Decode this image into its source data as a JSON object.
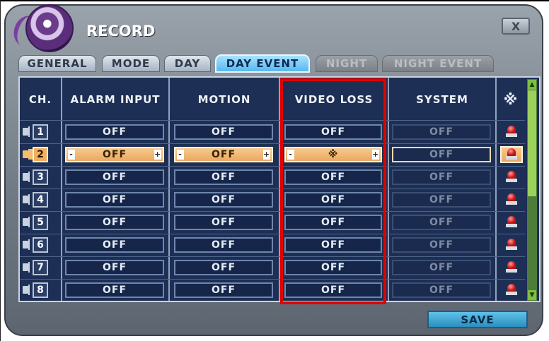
{
  "window": {
    "title": "RECORD",
    "close_label": "X"
  },
  "tabs": [
    {
      "label": "GENERAL",
      "state": "normal"
    },
    {
      "label": "MODE",
      "state": "normal"
    },
    {
      "label": "DAY",
      "state": "normal"
    },
    {
      "label": "DAY EVENT",
      "state": "active"
    },
    {
      "label": "NIGHT",
      "state": "disabled"
    },
    {
      "label": "NIGHT EVENT",
      "state": "disabled"
    }
  ],
  "table": {
    "headers": {
      "ch": "CH.",
      "alarm_input": "ALARM INPUT",
      "motion": "MOTION",
      "video_loss": "VIDEO LOSS",
      "system": "SYSTEM",
      "icon": "※"
    },
    "selected_row": 2,
    "rows": [
      {
        "ch": "1",
        "alarm_input": "OFF",
        "motion": "OFF",
        "video_loss": "OFF",
        "system": "OFF"
      },
      {
        "ch": "2",
        "alarm_input": "OFF",
        "motion": "OFF",
        "video_loss": "※",
        "system": "OFF"
      },
      {
        "ch": "3",
        "alarm_input": "OFF",
        "motion": "OFF",
        "video_loss": "OFF",
        "system": "OFF"
      },
      {
        "ch": "4",
        "alarm_input": "OFF",
        "motion": "OFF",
        "video_loss": "OFF",
        "system": "OFF"
      },
      {
        "ch": "5",
        "alarm_input": "OFF",
        "motion": "OFF",
        "video_loss": "OFF",
        "system": "OFF"
      },
      {
        "ch": "6",
        "alarm_input": "OFF",
        "motion": "OFF",
        "video_loss": "OFF",
        "system": "OFF"
      },
      {
        "ch": "7",
        "alarm_input": "OFF",
        "motion": "OFF",
        "video_loss": "OFF",
        "system": "OFF"
      },
      {
        "ch": "8",
        "alarm_input": "OFF",
        "motion": "OFF",
        "video_loss": "OFF",
        "system": "OFF"
      }
    ],
    "stepper": {
      "minus": "-",
      "plus": "+"
    }
  },
  "footer": {
    "save_label": "SAVE"
  },
  "colors": {
    "highlight": "#e00000",
    "panel": "#1d2f55",
    "selected": "#e9a85f",
    "active_tab": "#56b8ee"
  }
}
